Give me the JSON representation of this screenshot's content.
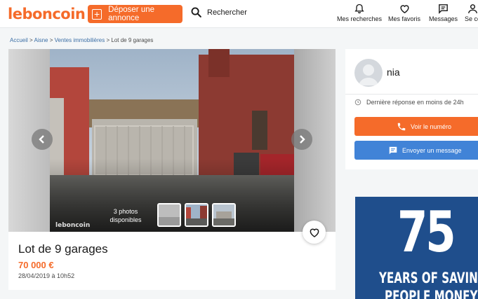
{
  "header": {
    "logo": "leboncoin",
    "post_label": "Déposer une annonce",
    "search_label": "Rechercher",
    "nav": [
      {
        "label": "Mes recherches",
        "icon": "bell-icon"
      },
      {
        "label": "Mes favoris",
        "icon": "heart-icon"
      },
      {
        "label": "Messages",
        "icon": "message-icon"
      },
      {
        "label": "Se co",
        "icon": "user-icon"
      }
    ]
  },
  "breadcrumb": {
    "items": [
      "Accueil",
      "Aisne",
      "Ventes immobilières"
    ],
    "separator": ">",
    "current": "Lot de 9 garages"
  },
  "gallery": {
    "photo_count": "3 photos disponibles",
    "watermark": "leboncoin",
    "thumbnails": 3
  },
  "listing": {
    "title": "Lot de 9 garages",
    "price": "70 000 €",
    "date": "28/04/2019 à 10h52"
  },
  "seller": {
    "name": "nia",
    "response": "Dernière réponse en moins de 24h",
    "phone_label": "Voir le numéro",
    "message_label": "Envoyer un message"
  },
  "ad": {
    "number": "75",
    "line1": "YEARS OF SAVING",
    "line2": "PEOPLE MONEY"
  },
  "colors": {
    "brand": "#f56b2a",
    "message_button": "#4183d7",
    "link": "#3b6ea5",
    "ad_background": "#1f4e8c"
  }
}
